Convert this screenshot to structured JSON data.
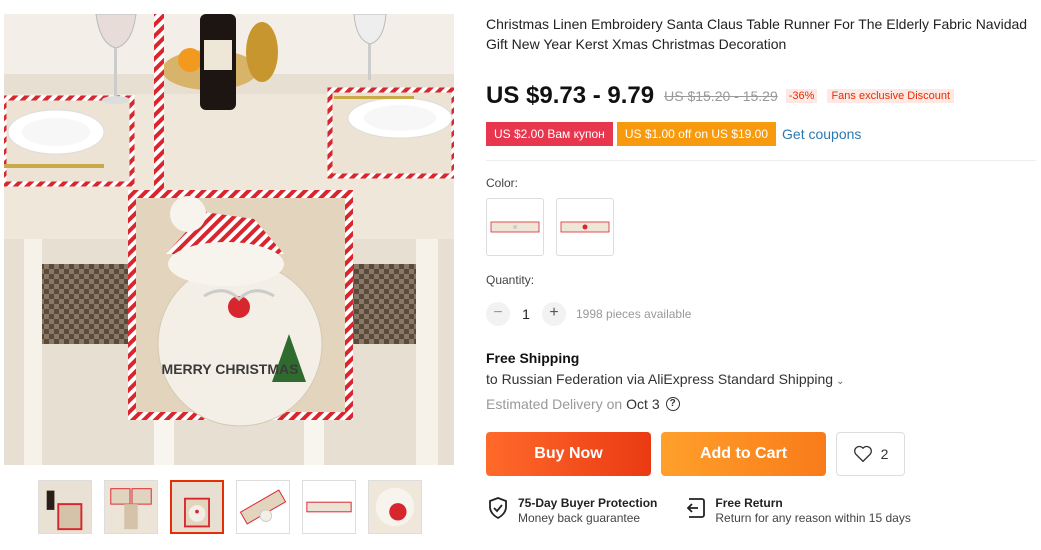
{
  "product": {
    "title": "Christmas Linen Embroidery Santa Claus Table Runner For The Elderly Fabric Navidad Gift New Year Kerst Xmas Christmas Decoration",
    "price": "US $9.73 - 9.79",
    "old_price": "US $15.20 - 15.29",
    "discount_pct": "-36%",
    "fans_discount": "Fans exclusive Discount"
  },
  "gallery": {
    "main_image_text": "MERRY CHRISTMAS",
    "thumbnails": [
      "thumb-1",
      "thumb-2",
      "thumb-3",
      "thumb-4",
      "thumb-5",
      "thumb-6"
    ],
    "active_thumbnail": 3
  },
  "coupons": {
    "coupon_1": "US $2.00 Вам купон",
    "coupon_2": "US $1.00 off on US $19.00",
    "get_coupons": "Get coupons"
  },
  "options": {
    "color_label": "Color:",
    "quantity_label": "Quantity:",
    "quantity_minus": "−",
    "quantity_value": "1",
    "quantity_plus": "+",
    "available": "1998 pieces available"
  },
  "shipping": {
    "title": "Free Shipping",
    "to": "to Russian Federation via AliExpress Standard Shipping",
    "estimated_label": "Estimated Delivery on",
    "estimated_date": "Oct 3"
  },
  "actions": {
    "buy_now": "Buy Now",
    "add_to_cart": "Add to Cart",
    "wishlist_count": "2"
  },
  "guarantees": {
    "protection_title": "75-Day Buyer Protection",
    "protection_sub": "Money back guarantee",
    "return_title": "Free Return",
    "return_sub": "Return for any reason within 15 days"
  },
  "colors": {
    "accent_red": "#e62e04",
    "coupon_red": "#e8364e",
    "coupon_orange": "#f89a0e",
    "link_blue": "#2a7ab0"
  }
}
